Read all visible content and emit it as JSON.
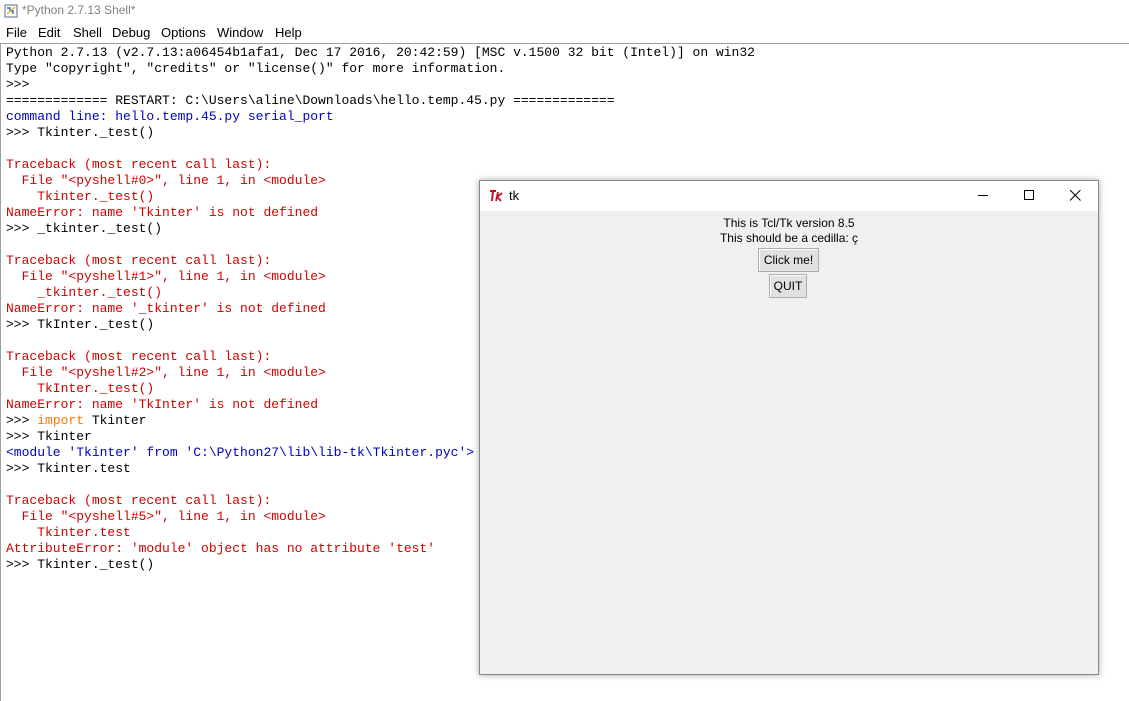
{
  "window": {
    "title": "*Python 2.7.13 Shell*"
  },
  "menu": [
    "File",
    "Edit",
    "Shell",
    "Debug",
    "Options",
    "Window",
    "Help"
  ],
  "shell_lines": [
    [
      {
        "t": "Python 2.7.13 (v2.7.13:a06454b1afa1, Dec 17 2016, 20:42:59) [MSC v.1500 32 bit (Intel)] on win32",
        "c": ""
      }
    ],
    [
      {
        "t": "Type \"copyright\", \"credits\" or \"license()\" for more information.",
        "c": ""
      }
    ],
    [
      {
        "t": ">>> ",
        "c": ""
      }
    ],
    [
      {
        "t": "============= RESTART: C:\\Users\\aline\\Downloads\\hello.temp.45.py =============",
        "c": ""
      }
    ],
    [
      {
        "t": "command line: hello.temp.45.py serial_port",
        "c": "blue"
      }
    ],
    [
      {
        "t": ">>> Tkinter._test()",
        "c": ""
      }
    ],
    [
      {
        "t": "",
        "c": ""
      }
    ],
    [
      {
        "t": "Traceback (most recent call last):",
        "c": "red"
      }
    ],
    [
      {
        "t": "  File \"<pyshell#0>\", line 1, in <module>",
        "c": "red"
      }
    ],
    [
      {
        "t": "    Tkinter._test()",
        "c": "red"
      }
    ],
    [
      {
        "t": "NameError: name 'Tkinter' is not defined",
        "c": "red"
      }
    ],
    [
      {
        "t": ">>> _tkinter._test()",
        "c": ""
      }
    ],
    [
      {
        "t": "",
        "c": ""
      }
    ],
    [
      {
        "t": "Traceback (most recent call last):",
        "c": "red"
      }
    ],
    [
      {
        "t": "  File \"<pyshell#1>\", line 1, in <module>",
        "c": "red"
      }
    ],
    [
      {
        "t": "    _tkinter._test()",
        "c": "red"
      }
    ],
    [
      {
        "t": "NameError: name '_tkinter' is not defined",
        "c": "red"
      }
    ],
    [
      {
        "t": ">>> TkInter._test()",
        "c": ""
      }
    ],
    [
      {
        "t": "",
        "c": ""
      }
    ],
    [
      {
        "t": "Traceback (most recent call last):",
        "c": "red"
      }
    ],
    [
      {
        "t": "  File \"<pyshell#2>\", line 1, in <module>",
        "c": "red"
      }
    ],
    [
      {
        "t": "    TkInter._test()",
        "c": "red"
      }
    ],
    [
      {
        "t": "NameError: name 'TkInter' is not defined",
        "c": "red"
      }
    ],
    [
      {
        "t": ">>> ",
        "c": ""
      },
      {
        "t": "import",
        "c": "orange"
      },
      {
        "t": " Tkinter",
        "c": ""
      }
    ],
    [
      {
        "t": ">>> Tkinter",
        "c": ""
      }
    ],
    [
      {
        "t": "<module 'Tkinter' from 'C:\\Python27\\lib\\lib-tk\\Tkinter.pyc'>",
        "c": "blue"
      }
    ],
    [
      {
        "t": ">>> Tkinter.test",
        "c": ""
      }
    ],
    [
      {
        "t": "",
        "c": ""
      }
    ],
    [
      {
        "t": "Traceback (most recent call last):",
        "c": "red"
      }
    ],
    [
      {
        "t": "  File \"<pyshell#5>\", line 1, in <module>",
        "c": "red"
      }
    ],
    [
      {
        "t": "    Tkinter.test",
        "c": "red"
      }
    ],
    [
      {
        "t": "AttributeError: 'module' object has no attribute 'test'",
        "c": "red"
      }
    ],
    [
      {
        "t": ">>> Tkinter._test()",
        "c": ""
      }
    ]
  ],
  "tk_window": {
    "title": "tk",
    "label_version": "This is Tcl/Tk version 8.5",
    "label_cedilla": "This should be a cedilla: ç",
    "click_button": "Click me!",
    "quit_button": "QUIT",
    "icons": [
      "tk-feather-icon",
      "minimize-icon",
      "maximize-icon",
      "close-icon"
    ]
  },
  "colors": {
    "error": "#d00000",
    "stdout": "#0000c0",
    "keyword": "#ff7700"
  }
}
